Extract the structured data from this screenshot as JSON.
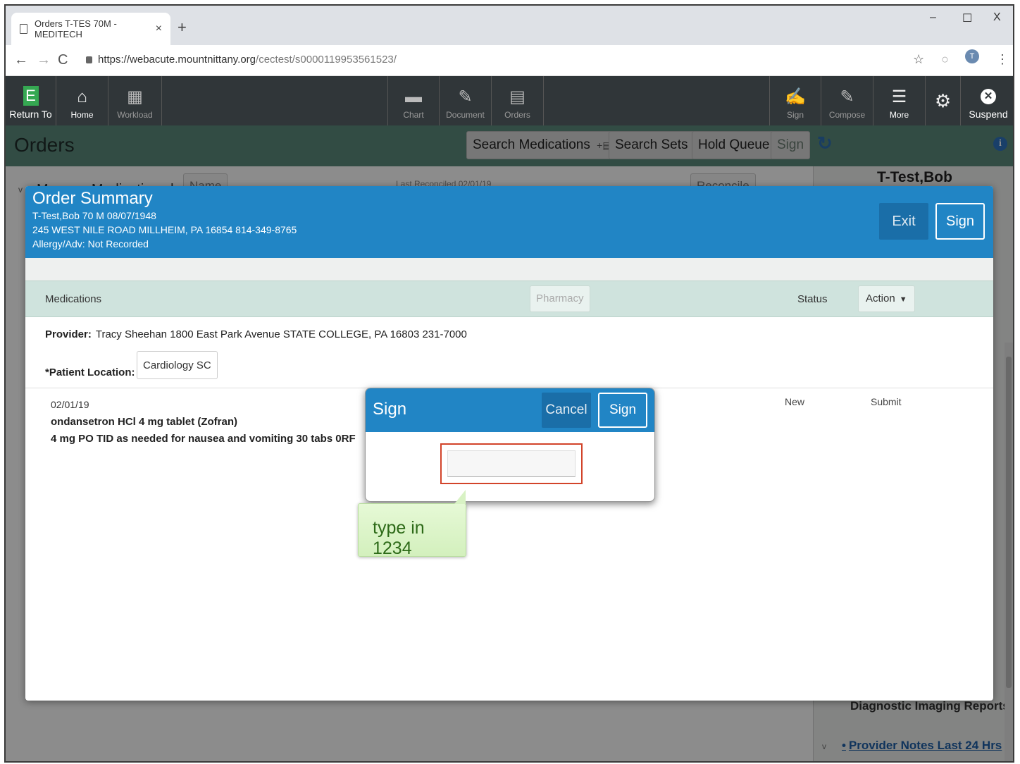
{
  "browser": {
    "tab_title": "Orders T-TES 70M - MEDITECH",
    "tab_close": "×",
    "new_tab": "+",
    "url_host": "https://webacute.mountnittany.org",
    "url_path": "/cectest/s0000119953561523/",
    "avatar_letter": "T",
    "window_controls": [
      "–",
      "☐",
      "X"
    ]
  },
  "toolbar": {
    "return_to": "Return To",
    "home": "Home",
    "workload": "Workload",
    "chart": "Chart",
    "document": "Document",
    "orders": "Orders",
    "sign": "Sign",
    "compose": "Compose",
    "more": "More",
    "suspend": "Suspend"
  },
  "page": {
    "title": "Orders",
    "search_medications": "Search Medications",
    "search_sets": "Search Sets",
    "hold_queue": "Hold Queue",
    "sign": "Sign"
  },
  "background": {
    "manage_medications": "Manage Medications by",
    "name_button": "Name",
    "last_reconciled": "Last Reconciled 02/01/19",
    "reconcile": "Reconcile",
    "patient_name": "T-Test,Bob",
    "diagnostic_imaging": "Diagnostic Imaging Reports",
    "provider_notes": "Provider Notes Last 24 Hrs"
  },
  "order_summary": {
    "title": "Order Summary",
    "patient_line": "T-Test,Bob 70 M 08/07/1948",
    "address_line": "245 WEST NILE ROAD MILLHEIM, PA 16854 814-349-8765",
    "allergy_line": "Allergy/Adv: Not Recorded",
    "exit": "Exit",
    "sign": "Sign",
    "columns": {
      "medications": "Medications",
      "pharmacy": "Pharmacy",
      "status": "Status",
      "action": "Action"
    },
    "provider_label": "Provider:",
    "provider_value": "Tracy Sheehan  1800 East Park Avenue STATE COLLEGE, PA 16803  231-7000",
    "patient_location_label": "*Patient Location:",
    "patient_location_value": "Cardiology SC",
    "order": {
      "date": "02/01/19",
      "name": "ondansetron HCl 4 mg tablet (Zofran)",
      "sig": "4 mg PO TID as needed for nausea and vomiting 30 tabs 0RF",
      "status": "New",
      "action": "Submit"
    }
  },
  "sign_dialog": {
    "title": "Sign",
    "cancel": "Cancel",
    "sign": "Sign",
    "pin_value": ""
  },
  "tooltip": {
    "text": "type in 1234"
  },
  "colors": {
    "toolbar": "#303639",
    "header_green": "#5c8a7c",
    "modal_blue": "#2185c5",
    "highlight_red": "#d2442a",
    "tooltip_green": "#d3f0bd"
  }
}
